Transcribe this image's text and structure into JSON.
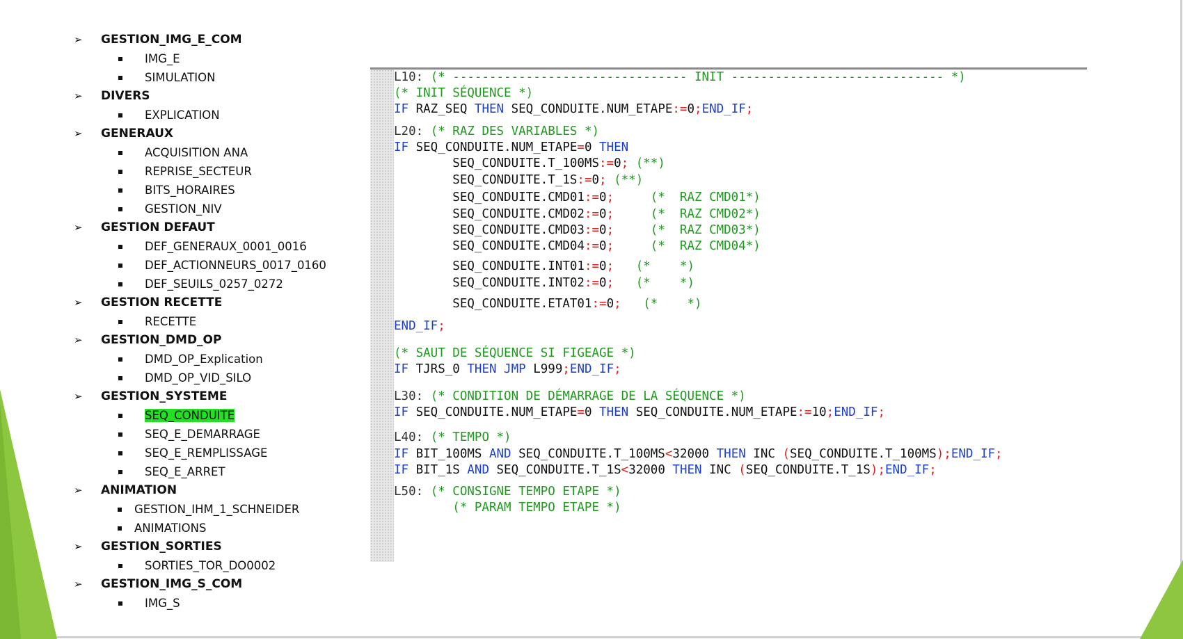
{
  "tree": [
    {
      "label": "GESTION_IMG_E_COM",
      "children": [
        "IMG_E",
        "SIMULATION"
      ]
    },
    {
      "label": "DIVERS",
      "children": [
        "EXPLICATION"
      ]
    },
    {
      "label": "GENERAUX",
      "children": [
        "ACQUISITION ANA",
        "REPRISE_SECTEUR",
        "BITS_HORAIRES",
        "GESTION_NIV"
      ]
    },
    {
      "label": "GESTION DEFAUT",
      "children": [
        "DEF_GENERAUX_0001_0016",
        "DEF_ACTIONNEURS_0017_0160",
        "DEF_SEUILS_0257_0272"
      ]
    },
    {
      "label": "GESTION RECETTE",
      "children": [
        "RECETTE"
      ]
    },
    {
      "label": "GESTION_DMD_OP",
      "children": [
        "DMD_OP_Explication",
        "DMD_OP_VID_SILO"
      ]
    },
    {
      "label": "GESTION_SYSTEME",
      "children": [
        "SEQ_CONDUITE",
        "SEQ_E_DEMARRAGE",
        "SEQ_E_REMPLISSAGE",
        "SEQ_E_ARRET"
      ]
    },
    {
      "label": "ANIMATION",
      "children": [
        "GESTION_IHM_1_SCHNEIDER",
        "ANIMATIONS"
      ]
    },
    {
      "label": "GESTION_SORTIES",
      "children": [
        "SORTIES_TOR_DO0002"
      ]
    },
    {
      "label": "GESTION_IMG_S_COM",
      "children": [
        "IMG_S"
      ]
    }
  ],
  "selected_item": "SEQ_CONDUITE",
  "code_lines": [
    [
      [
        "L10:",
        "lb"
      ],
      [
        " (* -------------------------------- INIT ----------------------------- *)",
        "cm"
      ]
    ],
    [
      [
        "(* INIT SÉQUENCE *)",
        "cm"
      ]
    ],
    [
      [
        "IF",
        "kw"
      ],
      [
        " RAZ_SEQ ",
        "tx"
      ],
      [
        "THEN",
        "kw"
      ],
      [
        " SEQ_CONDUITE.NUM_ETAPE",
        "tx"
      ],
      [
        ":=",
        "op"
      ],
      [
        "0",
        "tx"
      ],
      [
        ";",
        "op"
      ],
      [
        "END_IF",
        "kw"
      ],
      [
        ";",
        "op"
      ]
    ],
    [
      [
        "L20:",
        "lb"
      ],
      [
        " (* RAZ DES VARIABLES *)",
        "cm"
      ]
    ],
    [
      [
        "IF",
        "kw"
      ],
      [
        " SEQ_CONDUITE.NUM_ETAPE",
        "tx"
      ],
      [
        "=",
        "op"
      ],
      [
        "0 ",
        "tx"
      ],
      [
        "THEN",
        "kw"
      ]
    ],
    [
      [
        "        SEQ_CONDUITE.T_100MS",
        "tx"
      ],
      [
        ":=",
        "op"
      ],
      [
        "0",
        "tx"
      ],
      [
        ";",
        "op"
      ],
      [
        " (**)",
        "cm"
      ]
    ],
    [
      [
        "        SEQ_CONDUITE.T_1S",
        "tx"
      ],
      [
        ":=",
        "op"
      ],
      [
        "0",
        "tx"
      ],
      [
        ";",
        "op"
      ],
      [
        " (**)",
        "cm"
      ]
    ],
    [
      [
        "        SEQ_CONDUITE.CMD01",
        "tx"
      ],
      [
        ":=",
        "op"
      ],
      [
        "0",
        "tx"
      ],
      [
        ";",
        "op"
      ],
      [
        "     (*  RAZ CMD01*)",
        "cm"
      ]
    ],
    [
      [
        "        SEQ_CONDUITE.CMD02",
        "tx"
      ],
      [
        ":=",
        "op"
      ],
      [
        "0",
        "tx"
      ],
      [
        ";",
        "op"
      ],
      [
        "     (*  RAZ CMD02*)",
        "cm"
      ]
    ],
    [
      [
        "        SEQ_CONDUITE.CMD03",
        "tx"
      ],
      [
        ":=",
        "op"
      ],
      [
        "0",
        "tx"
      ],
      [
        ";",
        "op"
      ],
      [
        "     (*  RAZ CMD03*)",
        "cm"
      ]
    ],
    [
      [
        "        SEQ_CONDUITE.CMD04",
        "tx"
      ],
      [
        ":=",
        "op"
      ],
      [
        "0",
        "tx"
      ],
      [
        ";",
        "op"
      ],
      [
        "     (*  RAZ CMD04*)",
        "cm"
      ]
    ],
    [
      [
        "        SEQ_CONDUITE.INT01",
        "tx"
      ],
      [
        ":=",
        "op"
      ],
      [
        "0",
        "tx"
      ],
      [
        ";",
        "op"
      ],
      [
        "   (*    *)",
        "cm"
      ]
    ],
    [
      [
        "        SEQ_CONDUITE.INT02",
        "tx"
      ],
      [
        ":=",
        "op"
      ],
      [
        "0",
        "tx"
      ],
      [
        ";",
        "op"
      ],
      [
        "   (*    *)",
        "cm"
      ]
    ],
    [
      [
        "        SEQ_CONDUITE.ETAT01",
        "tx"
      ],
      [
        ":=",
        "op"
      ],
      [
        "0",
        "tx"
      ],
      [
        ";",
        "op"
      ],
      [
        "   (*    *)",
        "cm"
      ]
    ],
    [
      [
        "END_IF",
        "kw"
      ],
      [
        ";",
        "op"
      ]
    ],
    [
      [
        "(* SAUT DE SÉQUENCE SI FIGEAGE *)",
        "cm"
      ]
    ],
    [
      [
        "IF",
        "kw"
      ],
      [
        " TJRS_0 ",
        "tx"
      ],
      [
        "THEN JMP",
        "kw"
      ],
      [
        " L999",
        "tx"
      ],
      [
        ";",
        "op"
      ],
      [
        "END_IF",
        "kw"
      ],
      [
        ";",
        "op"
      ]
    ],
    [
      [
        "L30:",
        "lb"
      ],
      [
        " (* CONDITION DE DÉMARRAGE DE LA SÉQUENCE *)",
        "cm"
      ]
    ],
    [
      [
        "IF",
        "kw"
      ],
      [
        " SEQ_CONDUITE.NUM_ETAPE",
        "tx"
      ],
      [
        "=",
        "op"
      ],
      [
        "0 ",
        "tx"
      ],
      [
        "THEN",
        "kw"
      ],
      [
        " SEQ_CONDUITE.NUM_ETAPE",
        "tx"
      ],
      [
        ":=",
        "op"
      ],
      [
        "10",
        "tx"
      ],
      [
        ";",
        "op"
      ],
      [
        "END_IF",
        "kw"
      ],
      [
        ";",
        "op"
      ]
    ],
    [
      [
        "L40:",
        "lb"
      ],
      [
        " (* TEMPO *)",
        "cm"
      ]
    ],
    [
      [
        "IF",
        "kw"
      ],
      [
        " BIT_100MS ",
        "tx"
      ],
      [
        "AND",
        "kw"
      ],
      [
        " SEQ_CONDUITE.T_100MS",
        "tx"
      ],
      [
        "<",
        "op"
      ],
      [
        "32000 ",
        "tx"
      ],
      [
        "THEN",
        "kw"
      ],
      [
        " INC ",
        "tx"
      ],
      [
        "(",
        "op"
      ],
      [
        "SEQ_CONDUITE.T_100MS",
        "tx"
      ],
      [
        ");",
        "op"
      ],
      [
        "END_IF",
        "kw"
      ],
      [
        ";",
        "op"
      ]
    ],
    [
      [
        "IF",
        "kw"
      ],
      [
        " BIT_1S ",
        "tx"
      ],
      [
        "AND",
        "kw"
      ],
      [
        " SEQ_CONDUITE.T_1S",
        "tx"
      ],
      [
        "<",
        "op"
      ],
      [
        "32000 ",
        "tx"
      ],
      [
        "THEN",
        "kw"
      ],
      [
        " INC ",
        "tx"
      ],
      [
        "(",
        "op"
      ],
      [
        "SEQ_CONDUITE.T_1S",
        "tx"
      ],
      [
        ");",
        "op"
      ],
      [
        "END_IF",
        "kw"
      ],
      [
        ";",
        "op"
      ]
    ],
    [
      [
        "L50:",
        "lb"
      ],
      [
        " (* CONSIGNE TEMPO ETAPE *)",
        "cm"
      ]
    ],
    [
      [
        "        (* PARAM TEMPO ETAPE *)",
        "cm"
      ]
    ]
  ],
  "colors": {
    "comment": "#1f9a1f",
    "keyword": "#1a3fd4",
    "operator": "#e21c1c",
    "highlight": "#22e022",
    "accent_green": "#8dc63f"
  }
}
